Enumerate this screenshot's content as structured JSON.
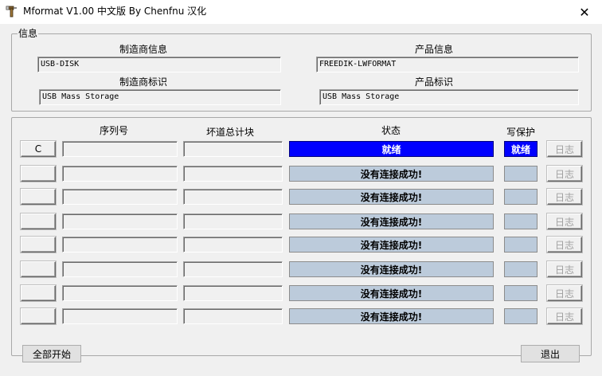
{
  "window": {
    "title": "Mformat V1.00 中文版 By Chenfnu 汉化",
    "icon": "hammer-icon",
    "close_glyph": "✕"
  },
  "info_group": {
    "legend": "信息",
    "manufacturer_info_label": "制造商信息",
    "manufacturer_info_value": "USB-DISK",
    "product_info_label": "产品信息",
    "product_info_value": "FREEDIK-LWFORMAT",
    "manufacturer_id_label": "制造商标识",
    "manufacturer_id_value": "USB Mass Storage",
    "product_id_label": "产品标识",
    "product_id_value": "USB Mass Storage"
  },
  "devices": {
    "headers": {
      "serial": "序列号",
      "bad_blocks": "坏道总计块",
      "status": "状态",
      "write_protect": "写保护"
    },
    "rows": [
      {
        "drive": "C",
        "serial": "",
        "bad_blocks": "",
        "status": "就绪",
        "write_protect": "就绪",
        "log": "日志",
        "state": "ready"
      },
      {
        "drive": "",
        "serial": "",
        "bad_blocks": "",
        "status": "没有连接成功!",
        "write_protect": "",
        "log": "日志",
        "state": "fail"
      },
      {
        "drive": "",
        "serial": "",
        "bad_blocks": "",
        "status": "没有连接成功!",
        "write_protect": "",
        "log": "日志",
        "state": "fail"
      },
      {
        "drive": "",
        "serial": "",
        "bad_blocks": "",
        "status": "没有连接成功!",
        "write_protect": "",
        "log": "日志",
        "state": "fail"
      },
      {
        "drive": "",
        "serial": "",
        "bad_blocks": "",
        "status": "没有连接成功!",
        "write_protect": "",
        "log": "日志",
        "state": "fail"
      },
      {
        "drive": "",
        "serial": "",
        "bad_blocks": "",
        "status": "没有连接成功!",
        "write_protect": "",
        "log": "日志",
        "state": "fail"
      },
      {
        "drive": "",
        "serial": "",
        "bad_blocks": "",
        "status": "没有连接成功!",
        "write_protect": "",
        "log": "日志",
        "state": "fail"
      },
      {
        "drive": "",
        "serial": "",
        "bad_blocks": "",
        "status": "没有连接成功!",
        "write_protect": "",
        "log": "日志",
        "state": "fail"
      }
    ]
  },
  "footer": {
    "start_all_label": "全部开始",
    "exit_label": "退出"
  },
  "colors": {
    "ready_bg": "#0000ff",
    "fail_bg": "#bccbdb"
  }
}
